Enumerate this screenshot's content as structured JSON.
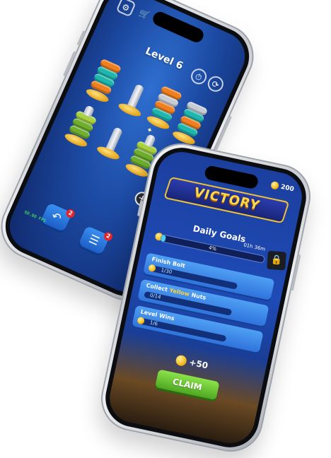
{
  "left_phone": {
    "level_title": "Level 6",
    "fps_text": "60.00 FPS",
    "undo_badge": "2",
    "hint_badge": "2",
    "icons": {
      "settings": "gear-icon",
      "shop": "cart-icon",
      "hint": "clock-icon",
      "restart": "refresh-icon",
      "undo": "undo-icon",
      "add": "plus-icon",
      "help": "person-list-icon"
    },
    "colors": {
      "background": "#1c4aa3",
      "nut_orange": "#f0801f",
      "nut_teal": "#1fb7ad",
      "nut_green": "#6fae2e",
      "base_gold": "#e3a21b"
    }
  },
  "right_phone": {
    "coins": "200",
    "banner": "VICTORY",
    "daily_title": "Daily Goals",
    "overall_progress_text": "4%",
    "overall_progress_value": 0.04,
    "timer": "01h 36m",
    "goals": [
      {
        "title": "Finish Bolt",
        "count": "1/30",
        "progress": 0.03
      },
      {
        "title_prefix": "Collect ",
        "title_highlight": "Yellow",
        "title_suffix": " Nuts",
        "count": "0/14",
        "progress": 0.0
      },
      {
        "title": "Level Wins",
        "count": "1/6",
        "progress": 0.17
      }
    ],
    "reward": "+50",
    "claim_label": "CLAIM",
    "colors": {
      "banner_text": "#fcd94a",
      "claim_button": "#4ea722",
      "goal_card": "#2f73dc",
      "highlight": "#ffd23c"
    }
  }
}
